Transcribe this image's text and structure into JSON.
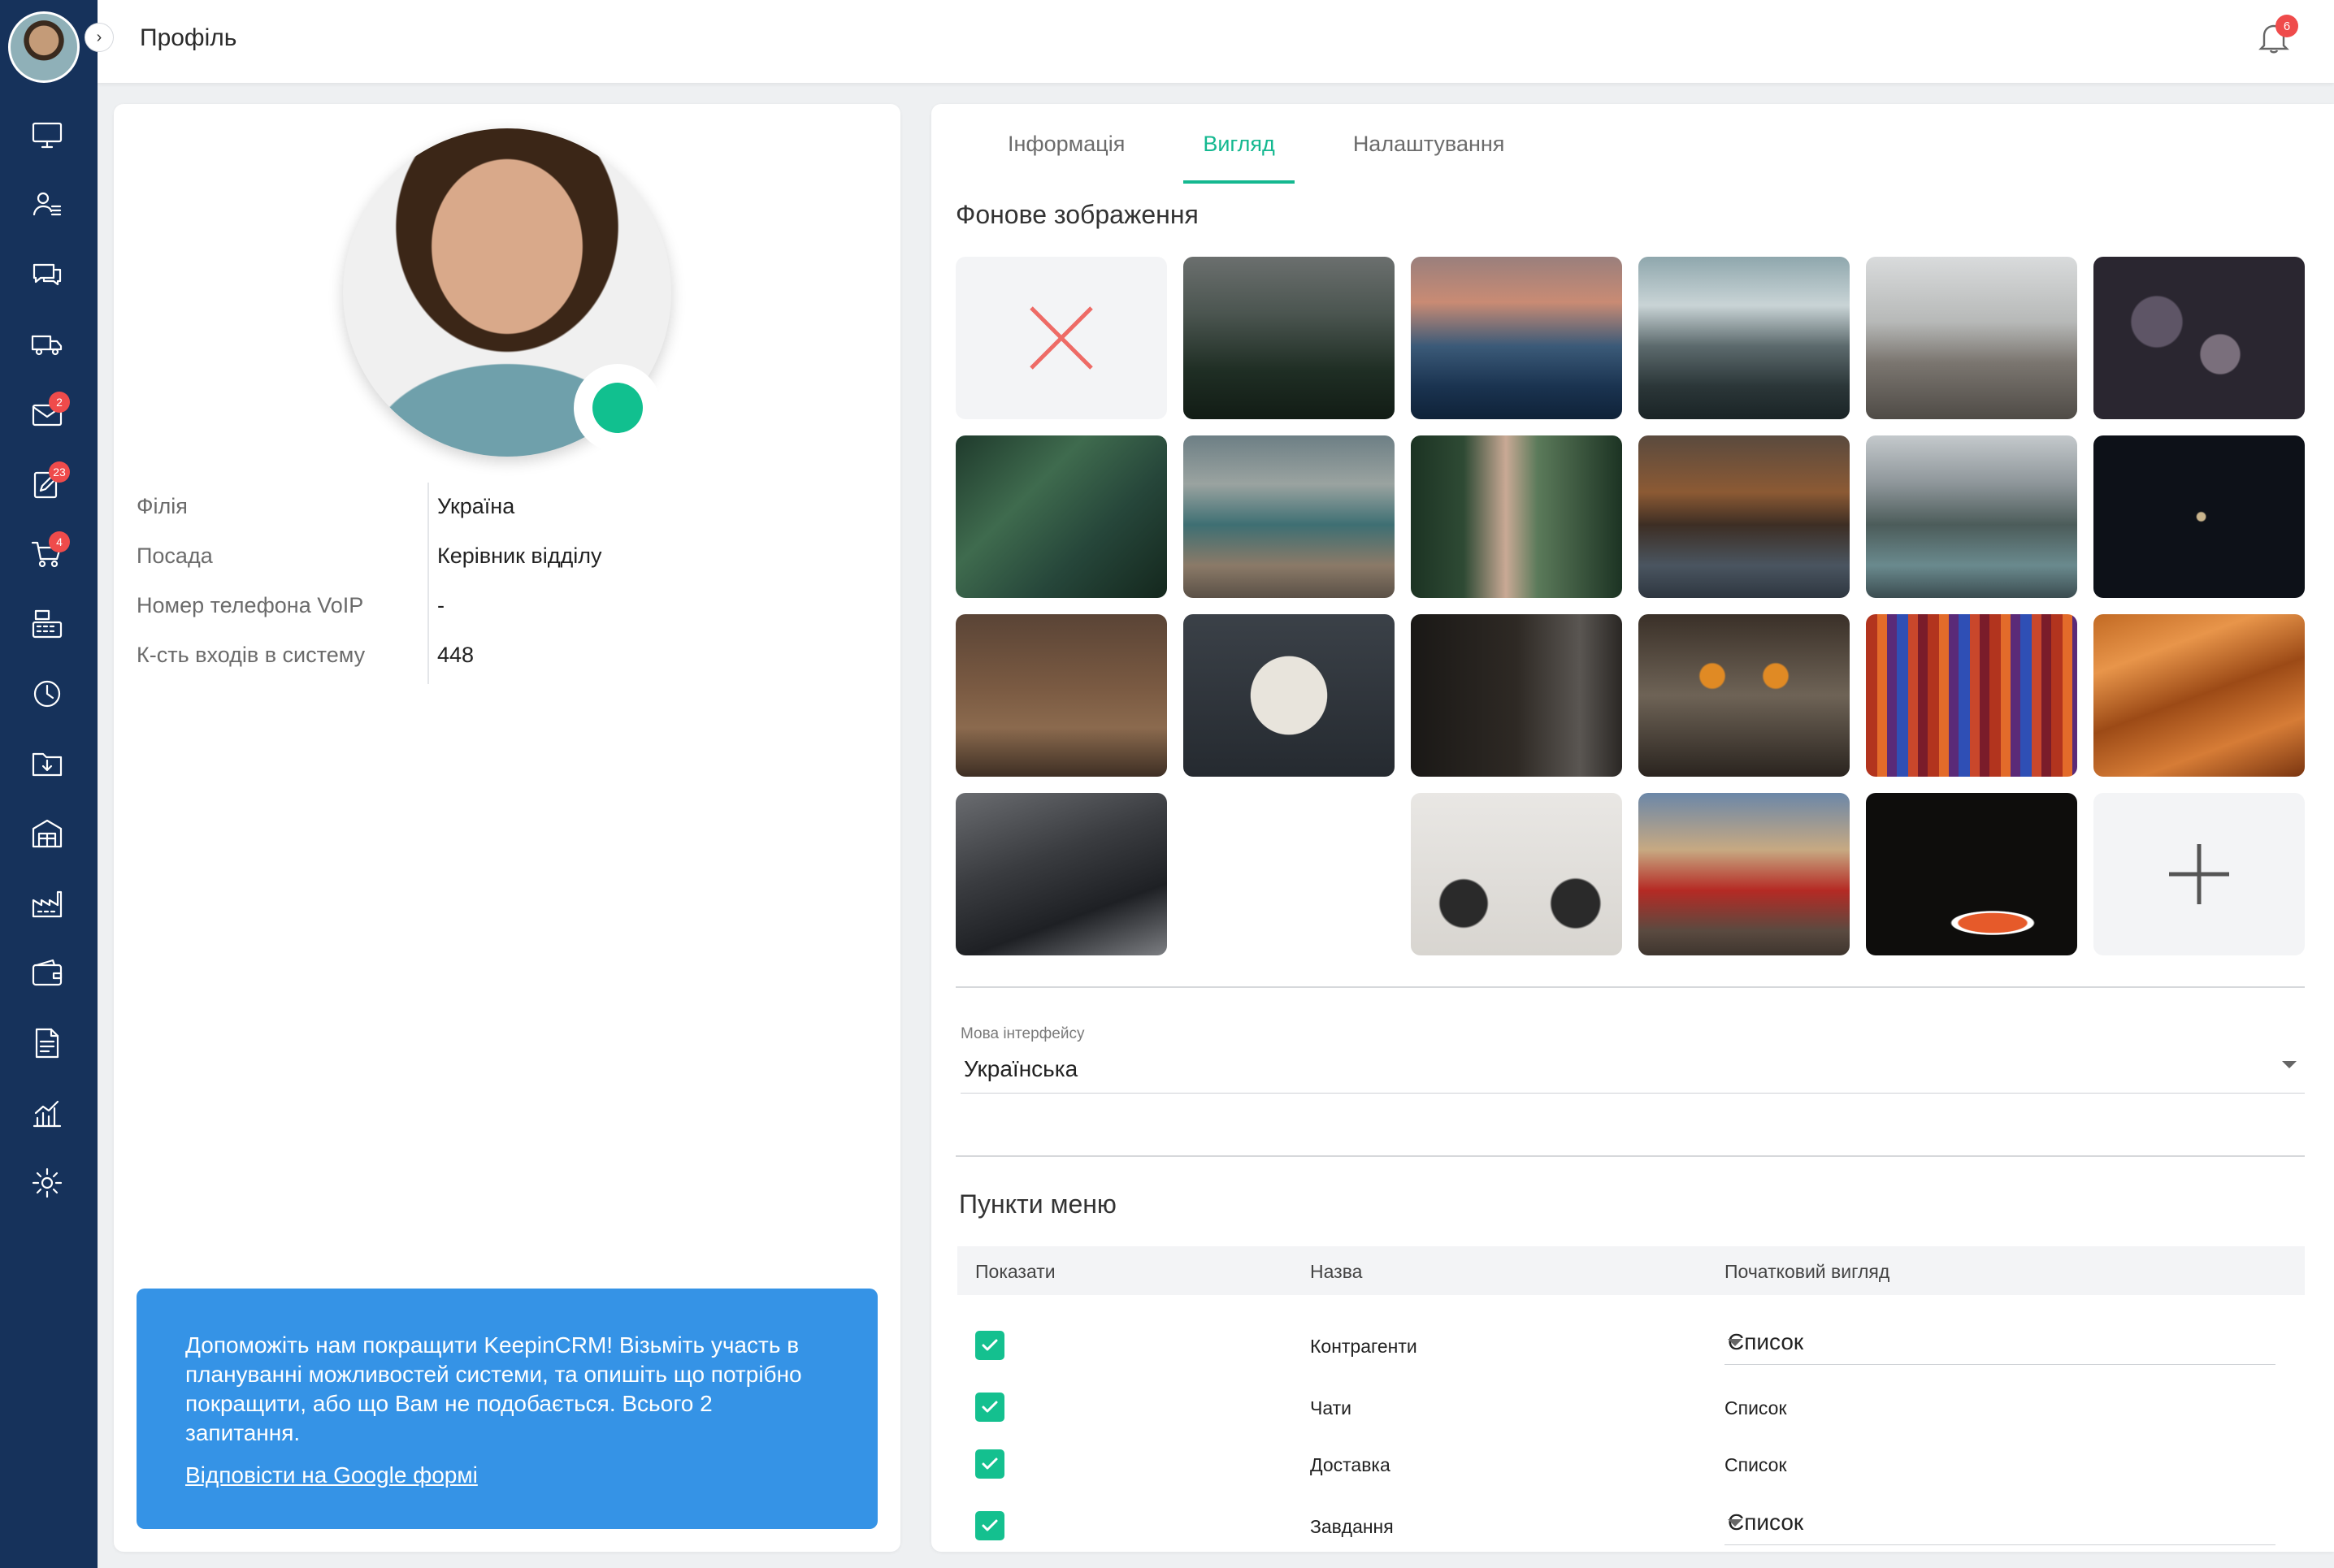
{
  "header": {
    "title": "Профіль",
    "notifications_count": "6"
  },
  "sidebar": {
    "items": [
      {
        "icon": "monitor-icon",
        "badge": ""
      },
      {
        "icon": "user-list-icon",
        "badge": ""
      },
      {
        "icon": "chat-icon",
        "badge": ""
      },
      {
        "icon": "truck-icon",
        "badge": ""
      },
      {
        "icon": "mail-icon",
        "badge": "2"
      },
      {
        "icon": "task-edit-icon",
        "badge": "23"
      },
      {
        "icon": "cart-icon",
        "badge": "4"
      },
      {
        "icon": "cash-register-icon",
        "badge": ""
      },
      {
        "icon": "clock-icon",
        "badge": ""
      },
      {
        "icon": "folder-download-icon",
        "badge": ""
      },
      {
        "icon": "warehouse-icon",
        "badge": ""
      },
      {
        "icon": "factory-icon",
        "badge": ""
      },
      {
        "icon": "wallet-icon",
        "badge": ""
      },
      {
        "icon": "document-icon",
        "badge": ""
      },
      {
        "icon": "analytics-icon",
        "badge": ""
      },
      {
        "icon": "gear-icon",
        "badge": ""
      }
    ]
  },
  "profile": {
    "fields": [
      {
        "label": "Філія",
        "value": "Україна"
      },
      {
        "label": "Посада",
        "value": "Керівник відділу"
      },
      {
        "label": "Номер телефона VoIP",
        "value": "-"
      },
      {
        "label": "К-сть входів в систему",
        "value": "448"
      }
    ],
    "status_color": "#11c08f"
  },
  "feedback": {
    "text": "Допоможіть нам покращити KeepinCRM! Візьміть участь в плануванні можливостей системи, та опишіть що потрібно покращити, або що Вам не подобається. Всього 2 запитання.",
    "link": "Відповісти на Google формі",
    "color": "#3593e6"
  },
  "tabs": [
    {
      "label": "Інформація",
      "active": false
    },
    {
      "label": "Вигляд",
      "active": true
    },
    {
      "label": "Налаштування",
      "active": false
    }
  ],
  "appearance": {
    "background_title": "Фонове зображення",
    "backgrounds": [
      "none",
      "foggy-forest",
      "ocean-wave",
      "snowy-mountain",
      "empty-road",
      "dark-succulents",
      "fern-leaves",
      "river-valley",
      "forest-valley",
      "autumn-lake",
      "mountain-lake-cabin",
      "night-moon",
      "deer",
      "french-bulldog",
      "cat-window",
      "owl",
      "colorful-stripes",
      "sand-dunes",
      "buildings",
      "blue-architecture",
      "motorcycle",
      "red-muscle-car",
      "night-road-lights",
      "add"
    ],
    "language_label": "Мова інтерфейсу",
    "language_value": "Українська",
    "menu_title": "Пункти меню",
    "menu_columns": [
      "Показати",
      "Назва",
      "Початковий вигляд"
    ],
    "menu_rows": [
      {
        "checked": true,
        "name": "Контрагенти",
        "view": "Список",
        "select": true
      },
      {
        "checked": true,
        "name": "Чати",
        "view": "Список",
        "select": false
      },
      {
        "checked": true,
        "name": "Доставка",
        "view": "Список",
        "select": false
      },
      {
        "checked": true,
        "name": "Завдання",
        "view": "Список",
        "select": true
      }
    ],
    "accent_color": "#14b890"
  }
}
